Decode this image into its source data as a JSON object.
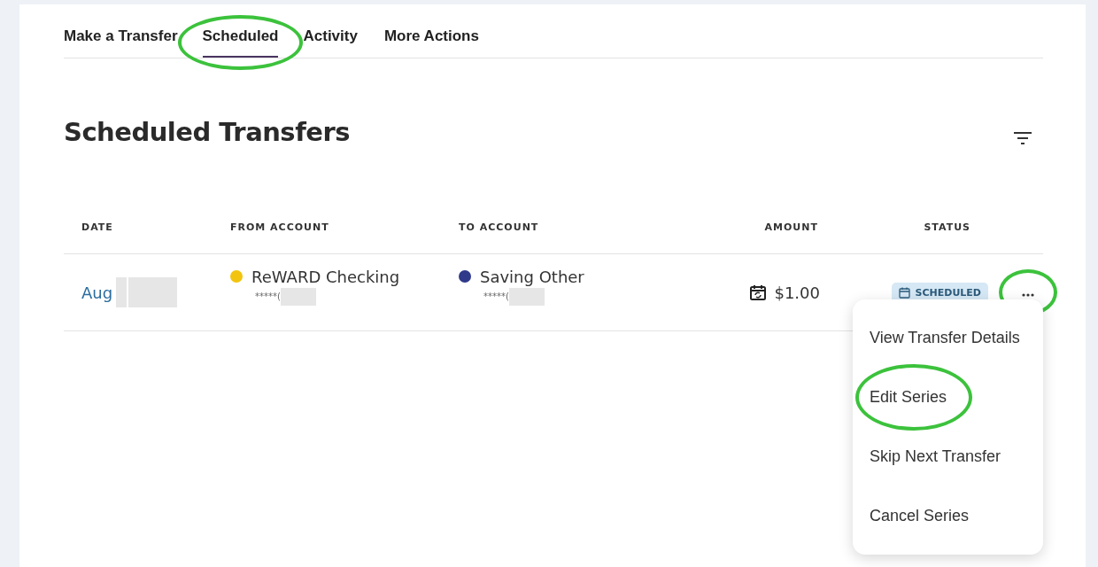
{
  "tabs": [
    {
      "label": "Make a Transfer",
      "selected": false,
      "highlighted": false
    },
    {
      "label": "Scheduled",
      "selected": true,
      "highlighted": true
    },
    {
      "label": "Activity",
      "selected": false,
      "highlighted": false
    },
    {
      "label": "More Actions",
      "selected": false,
      "highlighted": false
    }
  ],
  "heading": "Scheduled Transfers",
  "table": {
    "columns": [
      "DATE",
      "FROM ACCOUNT",
      "TO ACCOUNT",
      "AMOUNT",
      "STATUS"
    ],
    "rows": [
      {
        "date": "Aug",
        "date_redacted": true,
        "from": {
          "name": "ReWARD Checking",
          "color": "#f2c40f",
          "number": "*****(",
          "redacted": true
        },
        "to": {
          "name": "Saving Other",
          "color": "#2f3a8a",
          "number": "*****(",
          "redacted": true
        },
        "amount": "$1.00",
        "status": "SCHEDULED",
        "menu_highlighted": true
      }
    ]
  },
  "menu": {
    "items": [
      {
        "label": "View Transfer Details",
        "highlighted": false
      },
      {
        "label": "Edit Series",
        "highlighted": true
      },
      {
        "label": "Skip Next Transfer",
        "highlighted": false
      },
      {
        "label": "Cancel Series",
        "highlighted": false
      }
    ]
  }
}
